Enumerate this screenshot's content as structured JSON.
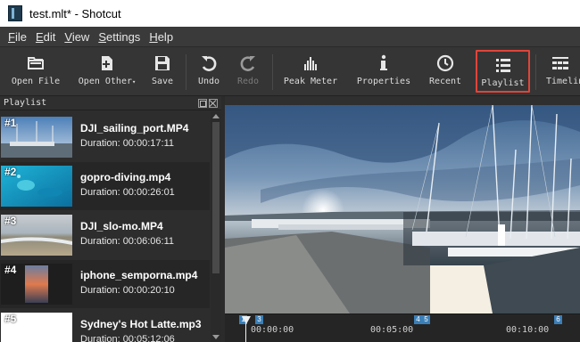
{
  "window": {
    "title": "test.mlt* - Shotcut"
  },
  "menu": [
    "File",
    "Edit",
    "View",
    "Settings",
    "Help"
  ],
  "toolbar": {
    "open_file": "Open File",
    "open_other": "Open Other",
    "save": "Save",
    "undo": "Undo",
    "redo": "Redo",
    "peak_meter": "Peak Meter",
    "properties": "Properties",
    "recent": "Recent",
    "playlist": "Playlist",
    "timeline": "Timeline"
  },
  "playlist": {
    "title": "Playlist",
    "items": [
      {
        "num": "#1",
        "name": "DJI_sailing_port.MP4",
        "duration": "Duration: 00:00:17:11"
      },
      {
        "num": "#2",
        "name": "gopro-diving.mp4",
        "duration": "Duration: 00:00:26:01"
      },
      {
        "num": "#3",
        "name": "DJI_slo-mo.MP4",
        "duration": "Duration: 00:06:06:11"
      },
      {
        "num": "#4",
        "name": "iphone_semporna.mp4",
        "duration": "Duration: 00:00:20:10"
      },
      {
        "num": "#5",
        "name": "Sydney's Hot Latte.mp3",
        "duration": "Duration: 00:05:12:06"
      }
    ]
  },
  "ruler": {
    "labels": [
      "00:00:00",
      "00:05:00",
      "00:10:00"
    ],
    "markers": [
      "1",
      "3",
      "4",
      "5",
      "6"
    ]
  },
  "colors": {
    "highlight": "#e0453a",
    "marker": "#3a7fb8",
    "background": "#2b2b2b"
  }
}
